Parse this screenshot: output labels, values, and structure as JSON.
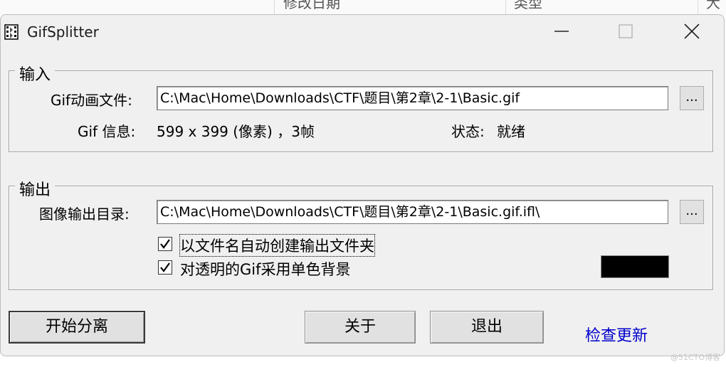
{
  "background": {
    "col1": "修改日期",
    "col2": "类型",
    "col3": "大"
  },
  "window": {
    "title": "GifSplitter",
    "controls": {
      "minimize": "minimize-icon",
      "maximize": "maximize-icon",
      "close": "close-icon"
    }
  },
  "input_group": {
    "legend": "输入",
    "file_label": "Gif动画文件:",
    "file_value": "C:\\Mac\\Home\\Downloads\\CTF\\题目\\第2章\\2-1\\Basic.gif",
    "browse_label": "...",
    "info_label": "Gif 信息:",
    "info_value": "599 x 399 (像素) ，3帧",
    "status_label": "状态:",
    "status_value": "就绪"
  },
  "output_group": {
    "legend": "输出",
    "dir_label": "图像输出目录:",
    "dir_value": "C:\\Mac\\Home\\Downloads\\CTF\\题目\\第2章\\2-1\\Basic.gif.ifl\\",
    "browse_label": "...",
    "option1": {
      "label": "以文件名自动创建输出文件夹",
      "checked": true
    },
    "option2": {
      "label": "对透明的Gif采用单色背景",
      "checked": true
    },
    "bg_color": "#000000"
  },
  "buttons": {
    "start": "开始分离",
    "about": "关于",
    "exit": "退出",
    "check_update": "检查更新"
  },
  "watermark": "@51CTO博客"
}
